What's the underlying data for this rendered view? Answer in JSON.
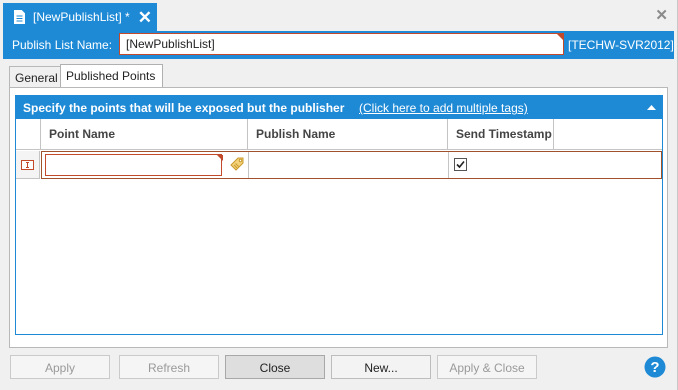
{
  "document_tab": {
    "title": "[NewPublishList] *",
    "close_glyph": "✕",
    "icon": "document-icon"
  },
  "window": {
    "close_glyph": "✕"
  },
  "header": {
    "label": "Publish List Name:",
    "name_value": "[NewPublishList]",
    "server": "[TECHW-SVR2012]"
  },
  "tabs": [
    {
      "label": "General",
      "active": false
    },
    {
      "label": "Published Points",
      "active": true
    }
  ],
  "group": {
    "title": "Specify the points that will be exposed but the publisher",
    "link": "(Click here to add multiple tags)",
    "collapse_icon": "chevron-up-icon"
  },
  "grid": {
    "columns": [
      "Point Name",
      "Publish Name",
      "Send Timestamp"
    ],
    "rows": [
      {
        "point_name": "",
        "publish_name": "",
        "send_timestamp": true
      }
    ]
  },
  "footer": {
    "buttons": [
      {
        "label": "Apply",
        "enabled": false
      },
      {
        "label": "Refresh",
        "enabled": false
      },
      {
        "label": "Close",
        "enabled": true
      },
      {
        "label": "New...",
        "enabled": true
      },
      {
        "label": "Apply & Close",
        "enabled": false
      }
    ],
    "help_icon": "help-icon"
  },
  "colors": {
    "accent": "#1e8ad6",
    "error": "#c24a2a"
  }
}
